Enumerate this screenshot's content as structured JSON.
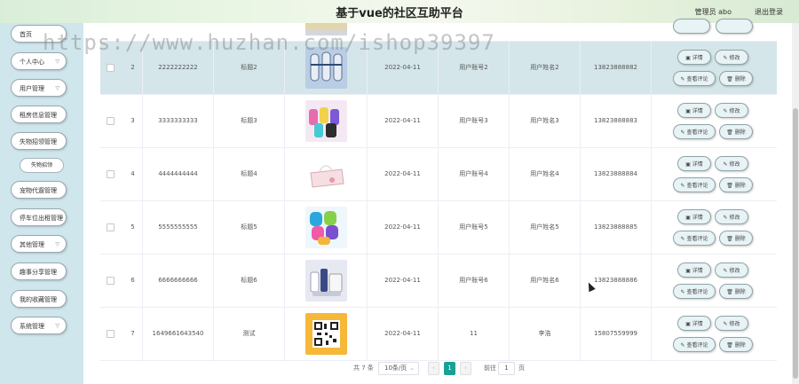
{
  "header": {
    "title": "基于vue的社区互助平台",
    "admin": "管理员 abo",
    "logout": "退出登录"
  },
  "sidebar": {
    "items": [
      {
        "label": "首页",
        "arrow": false
      },
      {
        "label": "个人中心",
        "arrow": true
      },
      {
        "label": "用户管理",
        "arrow": true
      },
      {
        "label": "租房信息管理",
        "arrow": false
      },
      {
        "label": "失物招领管理",
        "arrow": false
      },
      {
        "label": "宠物代遛管理",
        "arrow": false
      },
      {
        "label": "停车位出租管理",
        "arrow": false
      },
      {
        "label": "其他管理",
        "arrow": true
      },
      {
        "label": "趣事分享管理",
        "arrow": false
      },
      {
        "label": "我的收藏管理",
        "arrow": false
      },
      {
        "label": "系统管理",
        "arrow": true
      }
    ],
    "sub": "失物招领"
  },
  "buttons": {
    "detail": "详情",
    "edit": "修改",
    "comment": "查看评论",
    "delete": "删除"
  },
  "rows": [
    {
      "index": "2",
      "code": "2222222222",
      "title": "标题2",
      "date": "2022-04-11",
      "account": "用户账号2",
      "name": "用户姓名2",
      "phone": "13823888882",
      "img": "blue-slippers"
    },
    {
      "index": "3",
      "code": "3333333333",
      "title": "标题3",
      "date": "2022-04-11",
      "account": "用户账号3",
      "name": "用户姓名3",
      "phone": "13823888883",
      "img": "colorful-rolls"
    },
    {
      "index": "4",
      "code": "4444444444",
      "title": "标题4",
      "date": "2022-04-11",
      "account": "用户账号4",
      "name": "用户姓名4",
      "phone": "13823888884",
      "img": "tissue-box"
    },
    {
      "index": "5",
      "code": "5555555555",
      "title": "标题5",
      "date": "2022-04-11",
      "account": "用户账号5",
      "name": "用户姓名5",
      "phone": "13823888885",
      "img": "color-towels"
    },
    {
      "index": "6",
      "code": "6666666666",
      "title": "标题6",
      "date": "2022-04-11",
      "account": "用户账号6",
      "name": "用户姓名6",
      "phone": "13823888886",
      "img": "toiletries"
    },
    {
      "index": "7",
      "code": "1649661643540",
      "title": "测试",
      "date": "2022-04-11",
      "account": "11",
      "name": "李浩",
      "phone": "15807559999",
      "img": "qr-code"
    }
  ],
  "pagination": {
    "total": "共 7 条",
    "page_size": "10条/页",
    "current": "1",
    "goto": "前往",
    "goto_value": "1",
    "page_unit": "页"
  },
  "watermark": "https://www.huzhan.com/ishop39397",
  "colors": {
    "highlight_row": "#d4e6ea",
    "sidebar_bg": "#d0e6ed",
    "active_page": "#1aa094"
  }
}
